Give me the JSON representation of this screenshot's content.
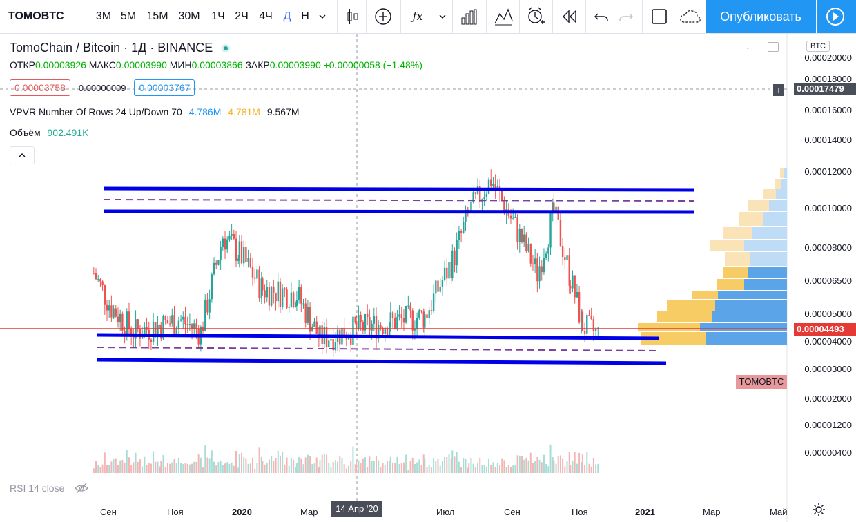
{
  "toolbar": {
    "symbol": "TOMOBTC",
    "intervals": [
      "3М",
      "5М",
      "15М",
      "30М",
      "1Ч",
      "2Ч",
      "4Ч",
      "Д",
      "Н"
    ],
    "active_interval": "Д",
    "publish_label": "Опубликовать"
  },
  "legend": {
    "title": "TomoChain / Bitcoin · 1Д · BINANCE",
    "ohlc": {
      "open_label": "ОТКР",
      "open": "0.00003926",
      "high_label": "МАКС",
      "high": "0.00003990",
      "low_label": "МИН",
      "low": "0.00003866",
      "close_label": "ЗАКР",
      "close": "0.00003990",
      "change": "+0.00000058 (+1.48%)"
    },
    "bid": "0.00003758",
    "spread": "0.00000009",
    "ask": "0.00003767",
    "vpvr_label": "VPVR Number Of Rows 24 Up/Down 70",
    "vpvr_up": "4.786M",
    "vpvr_down": "4.781M",
    "vpvr_total": "9.567M",
    "volume_label": "Объём",
    "volume_value": "902.491K"
  },
  "price_axis": {
    "currency_badge": "BTC",
    "labels": [
      "0.00020000",
      "0.00018000",
      "0.00016000",
      "0.00014000",
      "0.00012000",
      "0.00010000",
      "0.00008000",
      "0.00006500",
      "0.00005000",
      "0.00004000",
      "0.00003000",
      "0.00002000",
      "0.00001200",
      "0.00000400"
    ],
    "crosshair_price": "0.00017479",
    "last_price": "0.00004493",
    "last_price_color": "#e53935"
  },
  "series_tag": "TOMOBTC",
  "rsi_label": "RSI 14 close",
  "time_axis": {
    "labels": [
      "Сен",
      "Ноя",
      "2020",
      "Мар",
      "Июл",
      "Сен",
      "Ноя",
      "2021",
      "Мар",
      "Май"
    ],
    "crosshair_date": "14 Апр '20"
  },
  "colors": {
    "up": "#26a69a",
    "down": "#ef5350",
    "channel": "#0000e6",
    "midline": "#7b3fa0",
    "accent": "#2196f3"
  },
  "chart_data": {
    "type": "candlestick",
    "title": "TomoChain / Bitcoin · 1Д · BINANCE",
    "x_range": [
      "2019-08",
      "2021-05"
    ],
    "y_range": [
      2e-06,
      0.0002
    ],
    "y_scale": "log",
    "close_series": [
      {
        "date": "2019-08-20",
        "close": 6.2e-05
      },
      {
        "date": "2019-09-05",
        "close": 4.8e-05
      },
      {
        "date": "2019-09-25",
        "close": 4e-05
      },
      {
        "date": "2019-10-20",
        "close": 4.2e-05
      },
      {
        "date": "2019-11-05",
        "close": 4.4e-05
      },
      {
        "date": "2019-11-25",
        "close": 4e-05
      },
      {
        "date": "2019-12-15",
        "close": 8.2e-05
      },
      {
        "date": "2019-12-30",
        "close": 7.2e-05
      },
      {
        "date": "2020-01-20",
        "close": 5.5e-05
      },
      {
        "date": "2020-02-20",
        "close": 5.3e-05
      },
      {
        "date": "2020-03-12",
        "close": 3.8e-05
      },
      {
        "date": "2020-04-14",
        "close": 4.1e-05
      },
      {
        "date": "2020-05-15",
        "close": 4.3e-05
      },
      {
        "date": "2020-06-15",
        "close": 4.5e-05
      },
      {
        "date": "2020-07-10",
        "close": 6.8e-05
      },
      {
        "date": "2020-07-25",
        "close": 9.8e-05
      },
      {
        "date": "2020-08-14",
        "close": 0.000125
      },
      {
        "date": "2020-09-05",
        "close": 8.8e-05
      },
      {
        "date": "2020-09-25",
        "close": 6.2e-05
      },
      {
        "date": "2020-10-10",
        "close": 9.8e-05
      },
      {
        "date": "2020-10-25",
        "close": 6e-05
      },
      {
        "date": "2020-11-05",
        "close": 4.2e-05
      },
      {
        "date": "2020-11-20",
        "close": 3.9e-05
      }
    ],
    "volume_profile_visible": true,
    "horizontal_levels": [
      0.000108,
      9.9e-05,
      0.000104,
      4.25e-05,
      3.25e-05,
      3.7e-05
    ],
    "last_price_level": 4.493e-05
  }
}
